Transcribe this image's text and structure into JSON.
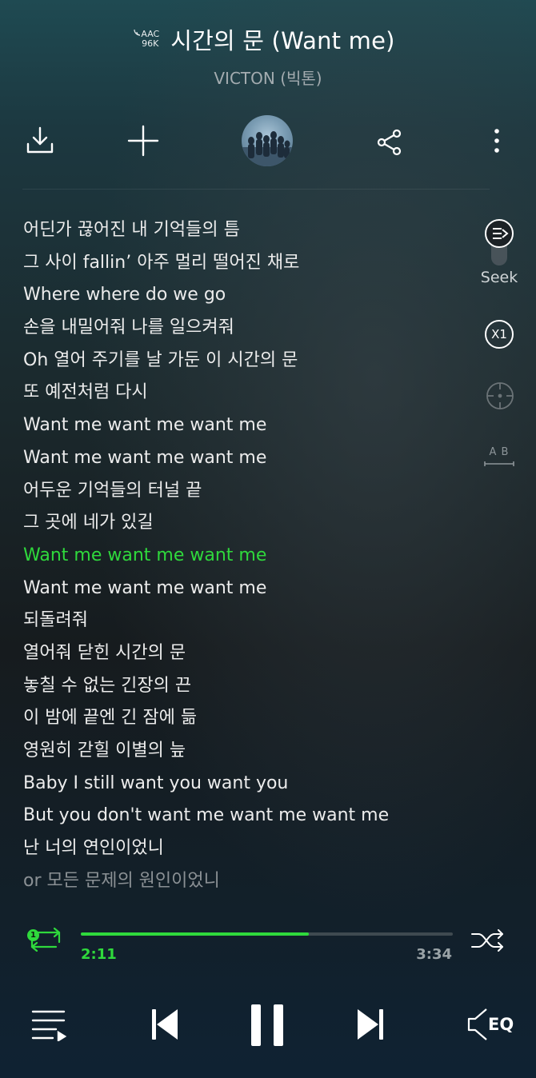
{
  "header": {
    "quality_top": "AAC",
    "quality_bottom": "96K",
    "title": "시간의 문 (Want me)",
    "artist": "VICTON (빅톤)"
  },
  "toolbar": {
    "download_icon": "download-icon",
    "add_icon": "plus-icon",
    "album_art": "album-art",
    "share_icon": "share-icon",
    "more_icon": "more-vertical-icon"
  },
  "lyrics": [
    "어딘가 끊어진 내 기억들의 틈",
    "그 사이 fallin’ 아주 멀리 떨어진 채로",
    "Where where do we go",
    "손을 내밀어줘 나를 일으켜줘",
    "Oh 열어 주기를 날 가둔 이 시간의 문",
    "또 예전처럼 다시",
    "Want me want me want me",
    "Want me want me want me",
    "어두운 기억들의 터널 끝",
    "그 곳에 네가 있길",
    "Want me want me want me",
    "Want me want me want me",
    "되돌려줘",
    "열어줘 닫힌 시간의 문",
    "놓칠 수 없는 긴장의 끈",
    "이 밤에 끝엔 긴 잠에 듦",
    "영원히 갇힐 이별의 늪",
    "Baby I still want you want you",
    "But you don't want me want me want me",
    "난 너의 연인이었니",
    "or 모든 문제의 원인이었니"
  ],
  "active_lyric_index": 10,
  "side": {
    "seek_label": "Seek",
    "speed_label": "X1",
    "ab_label": "A B"
  },
  "player": {
    "repeat_badge": "1",
    "current_time": "2:11",
    "total_time": "3:34",
    "progress": 0.612
  },
  "bottom": {
    "eq_label": "EQ"
  },
  "colors": {
    "accent": "#2fd93c",
    "text": "#ececec",
    "muted": "#a4acb0"
  }
}
